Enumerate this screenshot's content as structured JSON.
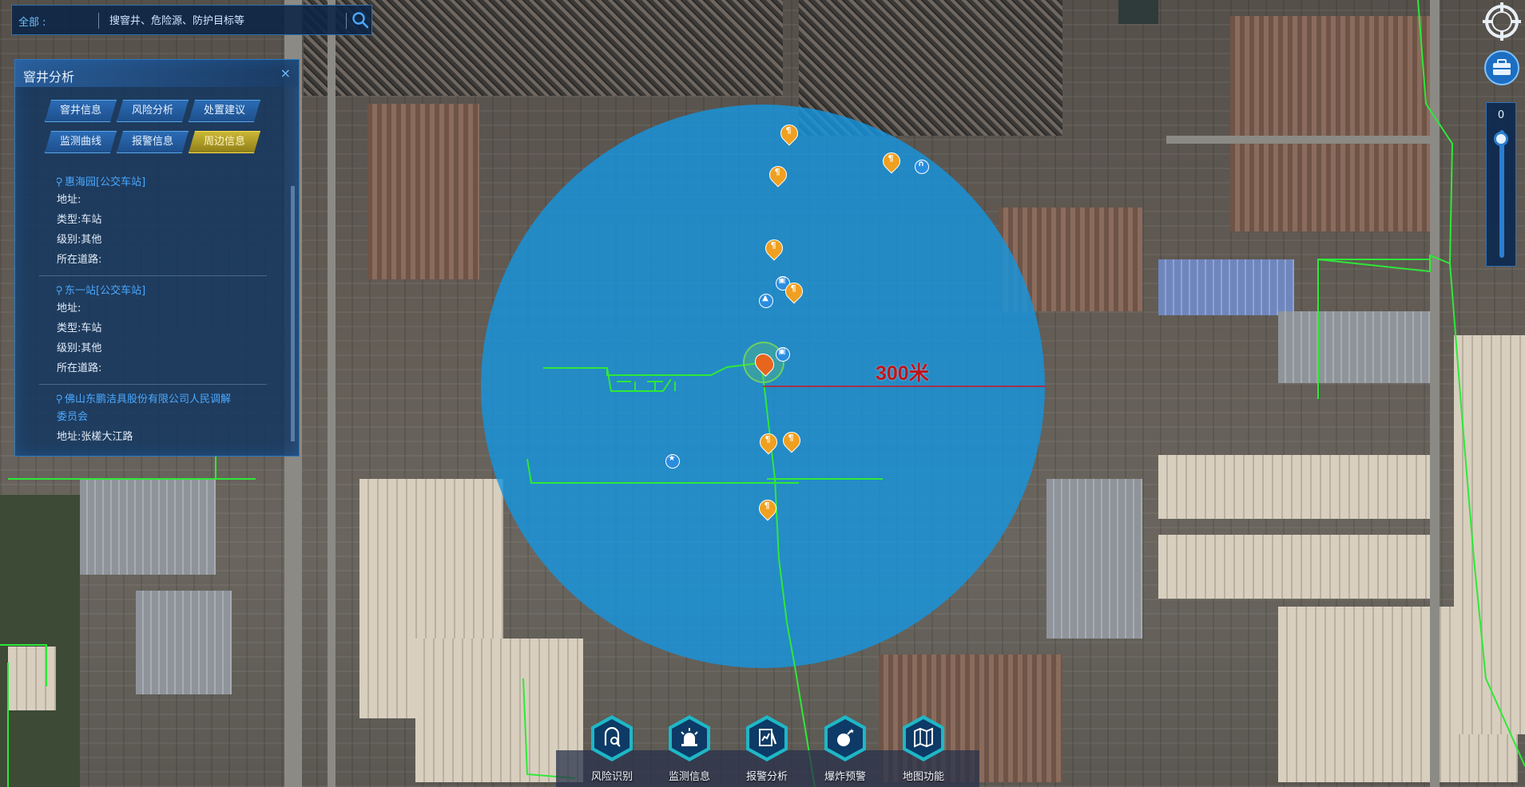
{
  "search": {
    "scope_label": "全部 :",
    "placeholder": "搜窨井、危险源、防护目标等",
    "icon": "search-icon"
  },
  "panel": {
    "title": "窨井分析",
    "close_label": "×",
    "tabs": [
      {
        "label": "窨井信息",
        "active": false
      },
      {
        "label": "风险分析",
        "active": false
      },
      {
        "label": "处置建议",
        "active": false
      },
      {
        "label": "监测曲线",
        "active": false
      },
      {
        "label": "报警信息",
        "active": false
      },
      {
        "label": "周边信息",
        "active": true
      }
    ],
    "poi_list": [
      {
        "name": "惠海园[公交车站]",
        "address": "地址:",
        "type": "类型:车站",
        "level": "级别:其他",
        "road": "所在道路:"
      },
      {
        "name": "东一站[公交车站]",
        "address": "地址:",
        "type": "类型:车站",
        "level": "级别:其他",
        "road": "所在道路:"
      },
      {
        "name_line1": "佛山东鹏洁具股份有限公司人民调解",
        "name_line2": "委员会",
        "address": "地址:张槎大江路"
      }
    ]
  },
  "map": {
    "radius_label": "300米",
    "circle_color": "#1496e1",
    "pipe_color": "#2ee838",
    "radius_line_color": "#d0141c"
  },
  "controls": {
    "zoom_value": "0",
    "compass_icon": "compass-icon",
    "toolbox_icon": "toolbox-icon"
  },
  "dock": {
    "items": [
      {
        "label": "风险识别",
        "icon": "risk-identify-icon"
      },
      {
        "label": "监测信息",
        "icon": "alarm-light-icon"
      },
      {
        "label": "报警分析",
        "icon": "alarm-analysis-icon"
      },
      {
        "label": "爆炸预警",
        "icon": "bomb-icon"
      },
      {
        "label": "地图功能",
        "icon": "map-function-icon"
      }
    ]
  }
}
